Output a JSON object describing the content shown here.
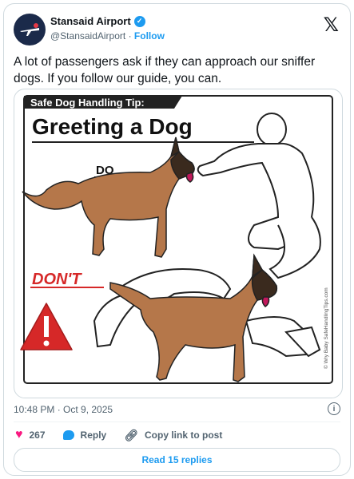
{
  "account": {
    "display_name": "Stansaid Airport",
    "handle": "@StansaidAirport",
    "separator": "·",
    "follow_label": "Follow"
  },
  "post": {
    "text": "A lot of passengers ask if they can approach our sniffer dogs. If you follow our guide, you can.",
    "timestamp": "10:48 PM · Oct 9, 2025"
  },
  "media": {
    "header_label": "Safe Dog Handling Tip:",
    "title": "Greeting a Dog",
    "do_label": "DO",
    "dont_label": "DON'T",
    "side_credit": "© Wry Baby  SafeHandlingTips.com"
  },
  "actions": {
    "like_count": "267",
    "reply_label": "Reply",
    "copy_link_label": "Copy link to post",
    "read_replies_label": "Read 15 replies"
  },
  "colors": {
    "accent": "#1d9bf0",
    "like": "#f91880",
    "dont_red": "#d62828"
  }
}
